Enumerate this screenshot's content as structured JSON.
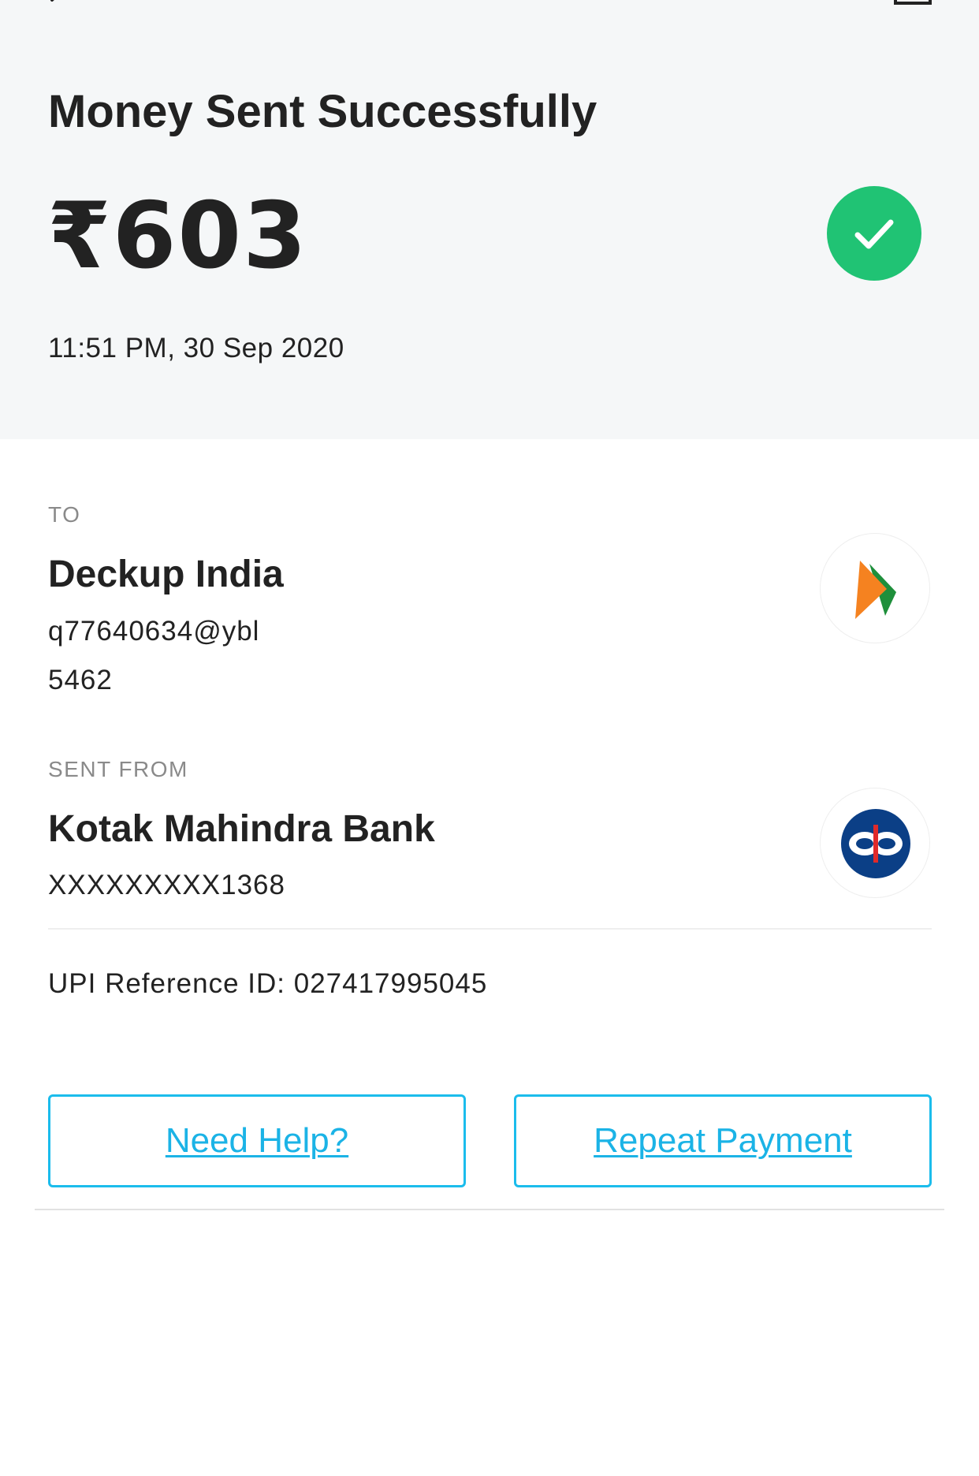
{
  "header": {
    "title": "Money Sent Successfully",
    "amount": "₹603",
    "timestamp": "11:51 PM, 30 Sep 2020"
  },
  "recipient": {
    "section_label": "TO",
    "name": "Deckup India",
    "upi_id": "q77640634@ybl",
    "code": "5462",
    "logo_icon": "bhim-upi-icon"
  },
  "sender": {
    "section_label": "SENT FROM",
    "bank_name": "Kotak Mahindra Bank",
    "account": "XXXXXXXXX1368",
    "logo_icon": "kotak-bank-icon"
  },
  "reference": {
    "text": "UPI Reference ID: 027417995045"
  },
  "actions": {
    "help_label": "Need Help?",
    "repeat_label": "Repeat Payment"
  },
  "colors": {
    "success_green": "#20c374",
    "accent_blue": "#1bb3e6",
    "header_bg": "#f5f7f8",
    "kotak_blue": "#0b3f86",
    "kotak_red": "#e02a2a",
    "upi_orange": "#f58220",
    "upi_green": "#1e8f3b"
  }
}
